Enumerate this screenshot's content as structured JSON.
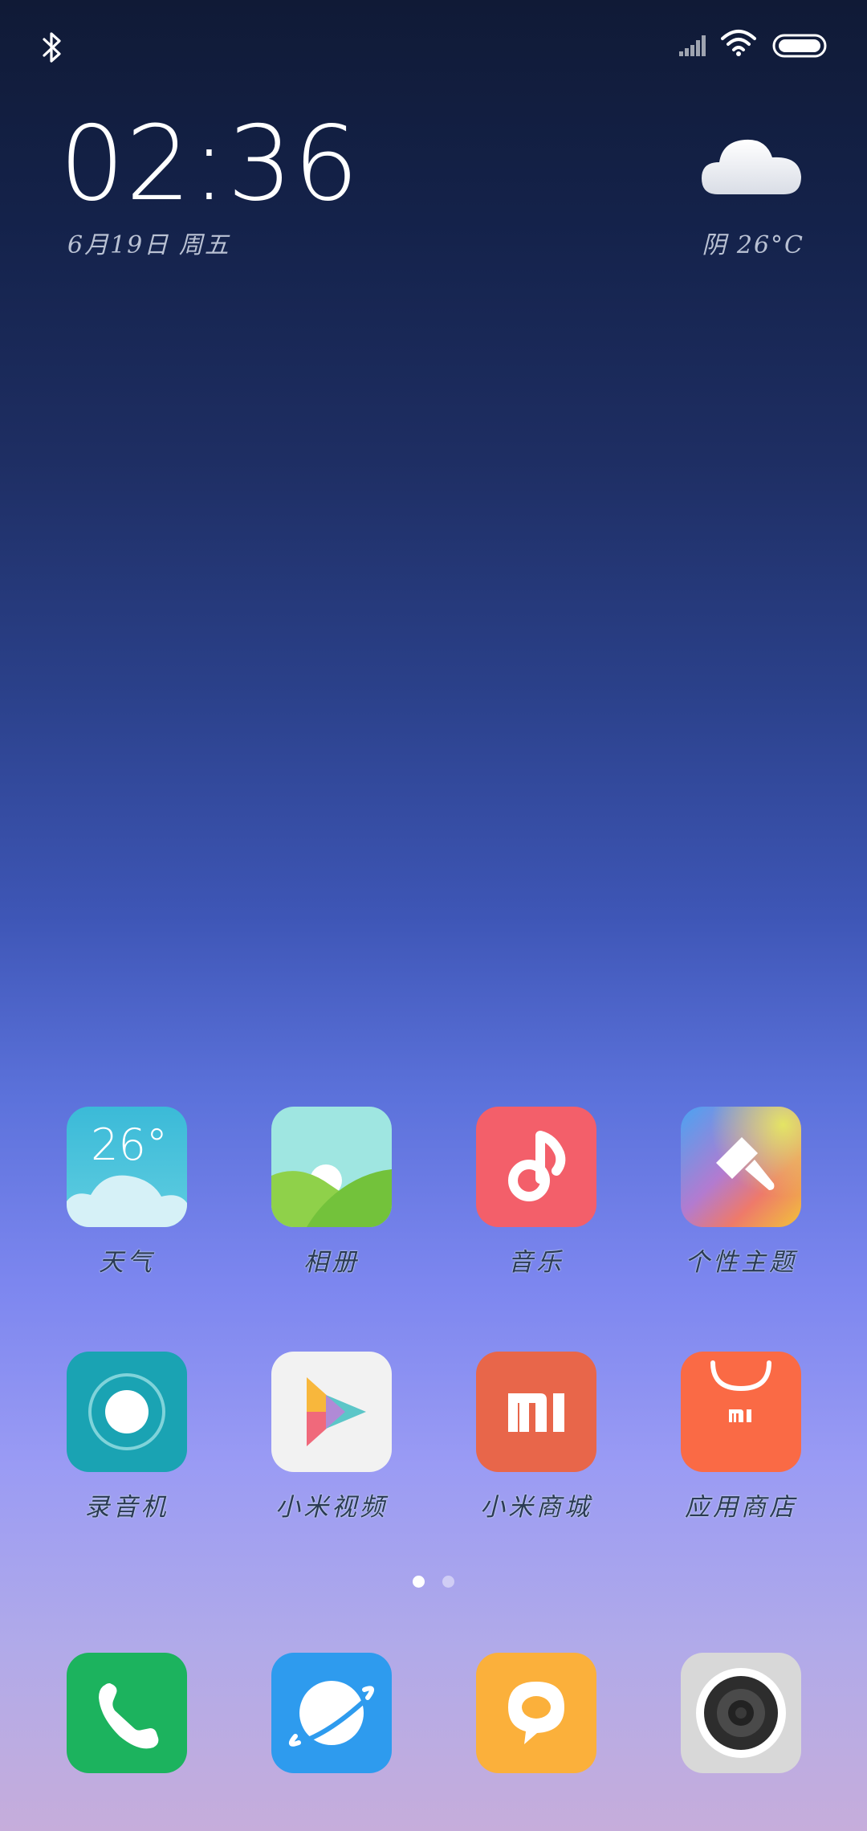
{
  "status_bar": {
    "left_icons": [
      "bluetooth-icon"
    ],
    "right_icons": [
      "cellular-signal-icon",
      "wifi-icon",
      "battery-icon"
    ]
  },
  "clock_widget": {
    "time": "02:36",
    "date": "6月19日 周五",
    "weather_icon": "cloud-icon",
    "weather": "阴 26°C"
  },
  "apps": {
    "row1": [
      {
        "label": "天气",
        "icon": "weather-icon",
        "icon_text": "26°",
        "color": "#3bbad8"
      },
      {
        "label": "相册",
        "icon": "gallery-icon",
        "color": "#8fd14a"
      },
      {
        "label": "音乐",
        "icon": "music-icon",
        "color": "#f35f6a"
      },
      {
        "label": "个性主题",
        "icon": "themes-icon",
        "color": "#e68a3c"
      }
    ],
    "row2": [
      {
        "label": "录音机",
        "icon": "recorder-icon",
        "color": "#1aa3b3"
      },
      {
        "label": "小米视频",
        "icon": "video-icon",
        "color": "#f2f2f2"
      },
      {
        "label": "小米商城",
        "icon": "mi-store-icon",
        "color": "#e8664a"
      },
      {
        "label": "应用商店",
        "icon": "app-store-icon",
        "color": "#fa6a45"
      }
    ]
  },
  "page_indicator": {
    "current": 1,
    "total": 2
  },
  "dock": [
    {
      "icon": "phone-icon",
      "color": "#1cb35e"
    },
    {
      "icon": "browser-icon",
      "color": "#2e9bee"
    },
    {
      "icon": "messaging-icon",
      "color": "#fbb03b"
    },
    {
      "icon": "camera-icon",
      "color": "#d8d8d8"
    }
  ]
}
